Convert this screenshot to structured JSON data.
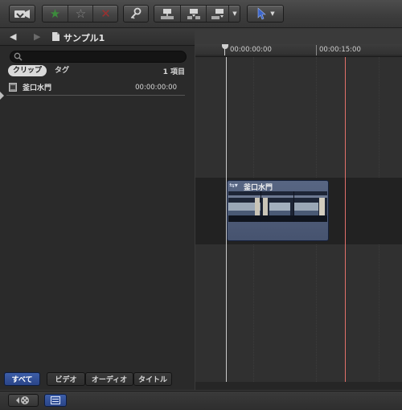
{
  "toolbar": {
    "import_icon": "camera-import-icon",
    "rating": {
      "favorite_icon": "star-filled-icon",
      "unrate_icon": "star-outline-icon",
      "reject_icon": "x-icon"
    },
    "keyword_icon": "key-icon",
    "edit_buttons": [
      "connect-clip-icon",
      "insert-clip-icon",
      "append-clip-icon"
    ],
    "tool_icon": "arrow-pointer-icon",
    "colors": {
      "favorite": "#3c8c3c",
      "reject": "#9a3030",
      "tool_accent": "#3b64c8"
    }
  },
  "browser": {
    "nav_back_icon": "back-arrow-icon",
    "nav_forward_icon": "forward-arrow-icon",
    "project_icon": "document-icon",
    "project_name": "サンプル1",
    "search": {
      "placeholder": ""
    },
    "tabs": {
      "clips": "クリップ",
      "tags": "タグ"
    },
    "item_count": "1 項目",
    "items": [
      {
        "name": "釜口水門",
        "timecode": "00:00:00:00",
        "icon": "film-clip-icon"
      }
    ],
    "filters": [
      {
        "label": "すべて",
        "active": true
      },
      {
        "label": "ビデオ",
        "active": false
      },
      {
        "label": "オーディオ",
        "active": false
      },
      {
        "label": "タイトル",
        "active": false
      }
    ]
  },
  "timeline": {
    "ruler": [
      "00:00:00:00",
      "00:00:15:00"
    ],
    "clip": {
      "title": "釜口水門",
      "icon": "clip-menu-icon"
    },
    "colors": {
      "playhead": "#e2706a",
      "clip": "#586683"
    }
  },
  "bottombar": {
    "left_icon": "film-reel-icon",
    "right_icon": "list-view-icon"
  }
}
